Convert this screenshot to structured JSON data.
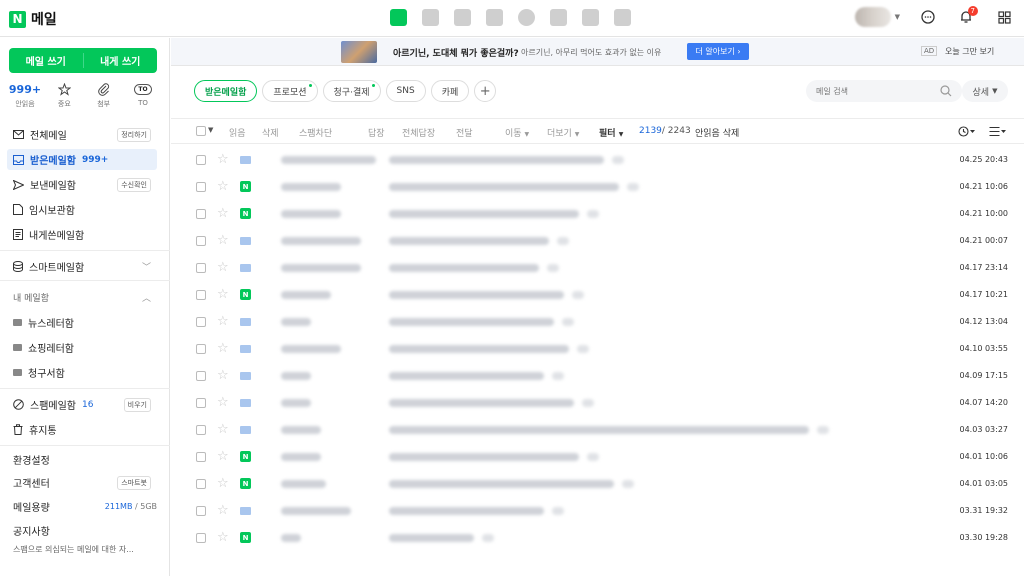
{
  "app": {
    "logo_letter": "N",
    "title": "메일"
  },
  "topbar": {
    "bell_count": "7"
  },
  "sidebar": {
    "compose_label": "메일 쓰기",
    "self_label": "내게 쓰기",
    "quick": [
      {
        "count": "999+",
        "label": "안읽음"
      },
      {
        "icon": "star-icon",
        "label": "중요"
      },
      {
        "icon": "paperclip-icon",
        "label": "첨부"
      },
      {
        "icon": "to-badge-icon",
        "badge": "TO",
        "label": "TO"
      }
    ],
    "items": {
      "all": {
        "label": "전체메일",
        "tag": "정리하기"
      },
      "inbox": {
        "label": "받은메일함",
        "count": "999+"
      },
      "sent": {
        "label": "보낸메일함",
        "tag": "수신확인"
      },
      "drafts": {
        "label": "임시보관함"
      },
      "self": {
        "label": "내게쓴메일함"
      },
      "smart": {
        "label": "스마트메일함"
      },
      "my_section": {
        "label": "내 메일함"
      },
      "newsletter": {
        "label": "뉴스레터함"
      },
      "shopping": {
        "label": "쇼핑레터함"
      },
      "billing": {
        "label": "청구서함"
      },
      "spam": {
        "label": "스팸메일함",
        "count": "16",
        "tag": "비우기"
      },
      "trash": {
        "label": "휴지통"
      },
      "settings": {
        "label": "환경설정"
      },
      "support": {
        "label": "고객센터",
        "tag": "스마트봇"
      },
      "storage": {
        "label": "메일용량",
        "used": "211MB",
        "total": "/ 5GB"
      },
      "notice": {
        "label": "공지사항",
        "text": "스팸으로 의심되는 메일에 대한 자..."
      }
    }
  },
  "ad": {
    "title": "아르기닌, 도대체 뭐가 좋은걸까?",
    "desc": "아르기닌, 아무리 먹어도 효과가 없는 이유",
    "button": "더 알아보기",
    "tag": "AD",
    "close": "오늘 그만 보기"
  },
  "tabs": [
    {
      "label": "받은메일함",
      "active": true,
      "dot": false
    },
    {
      "label": "프로모션",
      "active": false,
      "dot": true
    },
    {
      "label": "청구·결제",
      "active": false,
      "dot": true
    },
    {
      "label": "SNS",
      "active": false,
      "dot": false
    },
    {
      "label": "카페",
      "active": false,
      "dot": false
    }
  ],
  "search": {
    "placeholder": "메일 검색",
    "detail": "상세"
  },
  "toolbar": {
    "read": "읽음",
    "delete": "삭제",
    "spam_block": "스팸차단",
    "reply": "답장",
    "reply_all": "전체답장",
    "forward": "전달",
    "move": "이동",
    "more": "더보기",
    "filter": "필터",
    "unread_count": "2139",
    "total_count": "/ 2243",
    "delete_unread": "안읽음 삭제"
  },
  "mails": [
    {
      "type": "mail",
      "date": "04.25 20:43"
    },
    {
      "type": "naver",
      "date": "04.21 10:06"
    },
    {
      "type": "naver",
      "date": "04.21 10:00"
    },
    {
      "type": "mail",
      "date": "04.21 00:07"
    },
    {
      "type": "mail",
      "date": "04.17 23:14"
    },
    {
      "type": "naver",
      "date": "04.17 10:21"
    },
    {
      "type": "mail",
      "date": "04.12 13:04"
    },
    {
      "type": "mail",
      "date": "04.10 03:55"
    },
    {
      "type": "mail",
      "date": "04.09 17:15"
    },
    {
      "type": "mail",
      "date": "04.07 14:20"
    },
    {
      "type": "mail",
      "date": "04.03 03:27"
    },
    {
      "type": "naver",
      "date": "04.01 10:06"
    },
    {
      "type": "naver",
      "date": "04.01 03:05"
    },
    {
      "type": "mail",
      "date": "03.31 19:32"
    },
    {
      "type": "naver",
      "date": "03.30 19:28"
    }
  ],
  "colors": {
    "brand": "#03c75a",
    "accent": "#1a66d9",
    "ad_button": "#3a7bf3"
  }
}
